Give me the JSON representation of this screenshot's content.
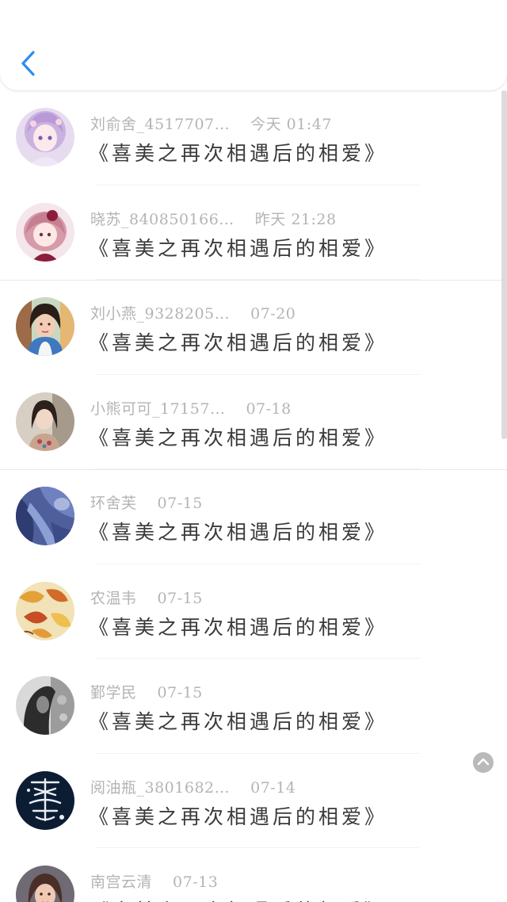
{
  "header": {
    "back_icon": "chevron-left-icon",
    "accent_color": "#2d8cf0"
  },
  "comments": [
    {
      "name": "刘俞舍_4517707…",
      "time": "今天 01:47",
      "book": "《喜美之再次相遇后的相爱》",
      "avatar": "anime-girl-purple"
    },
    {
      "name": "晓苏_840850166…",
      "time": "昨天 21:28",
      "book": "《喜美之再次相遇后的相爱》",
      "avatar": "anime-girl-pink"
    },
    {
      "name": "刘小燕_9328205…",
      "time": "07-20",
      "book": "《喜美之再次相遇后的相爱》",
      "avatar": "woman-photo"
    },
    {
      "name": "小熊可可_17157…",
      "time": "07-18",
      "book": "《喜美之再次相遇后的相爱》",
      "avatar": "girl-photo"
    },
    {
      "name": "环舍芙",
      "time": "07-15",
      "book": "《喜美之再次相遇后的相爱》",
      "avatar": "blue-fabric"
    },
    {
      "name": "农温韦",
      "time": "07-15",
      "book": "《喜美之再次相遇后的相爱》",
      "avatar": "autumn-leaves"
    },
    {
      "name": "鄞学民",
      "time": "07-15",
      "book": "《喜美之再次相遇后的相爱》",
      "avatar": "grayscale-photo"
    },
    {
      "name": "阅油瓶_3801682…",
      "time": "07-14",
      "book": "《喜美之再次相遇后的相爱》",
      "avatar": "calligraphy-dark"
    },
    {
      "name": "南宫云清",
      "time": "07-13",
      "book": "《喜美之再次相遇后的相爱》",
      "avatar": "woman-portrait"
    }
  ]
}
